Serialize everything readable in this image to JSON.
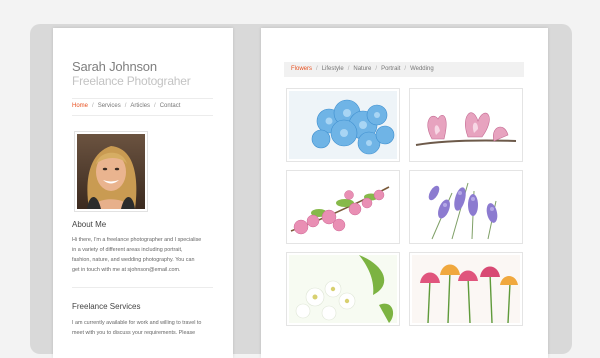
{
  "sidebar": {
    "title": "Sarah Johnson",
    "subtitle": "Freelance Photograher",
    "nav": [
      {
        "label": "Home",
        "active": true
      },
      {
        "label": "Services",
        "active": false
      },
      {
        "label": "Articles",
        "active": false
      },
      {
        "label": "Contact",
        "active": false
      }
    ],
    "about": {
      "heading": "About Me",
      "lines": [
        "Hi there, I'm a freelance photographer and I specialise",
        "in a variety of different areas including portrait,",
        "fashion, nature, and wedding photography. You can",
        "get in touch with me at sjohnson@email.com."
      ]
    },
    "services": {
      "heading": "Freelance Services",
      "lines": [
        "I am currently available for work and willing to travel to",
        "meet with you to discuss your requirements. Please"
      ]
    }
  },
  "gallery": {
    "filters": [
      {
        "label": "Flowers",
        "active": true
      },
      {
        "label": "Lifestyle",
        "active": false
      },
      {
        "label": "Nature",
        "active": false
      },
      {
        "label": "Portrait",
        "active": false
      },
      {
        "label": "Wedding",
        "active": false
      }
    ],
    "thumbnails": [
      {
        "name": "thumbnail-blue-hydrangea"
      },
      {
        "name": "thumbnail-pink-magnolia"
      },
      {
        "name": "thumbnail-pink-blossom"
      },
      {
        "name": "thumbnail-lavender"
      },
      {
        "name": "thumbnail-white-flowers"
      },
      {
        "name": "thumbnail-tulips"
      }
    ]
  },
  "colors": {
    "accent": "#e8501f",
    "title": "#7f7f7f",
    "subtitle": "#c3c3c3",
    "frame": "#d9d9d9"
  }
}
